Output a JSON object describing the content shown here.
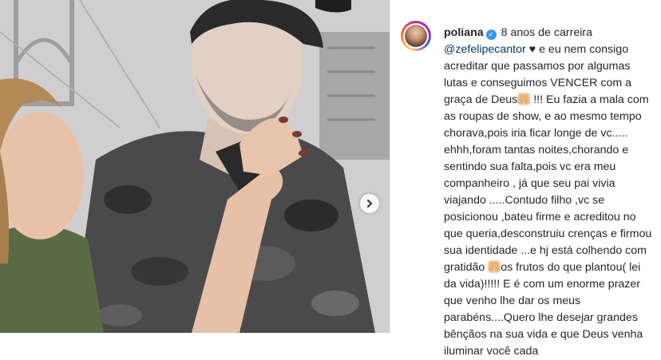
{
  "post": {
    "author": {
      "username": "poliana",
      "verified": true
    },
    "caption": {
      "line1": "8 anos de carreira",
      "mention": "@zefelipecantor",
      "heart": "♥",
      "segment1": "e eu nem consigo acreditar que passamos por algumas lutas e conseguimos VENCER com a graça de Deus",
      "segment2": "!!! Eu fazia a mala com as roupas de show, e ao mesmo tempo chorava,pois iria ficar longe de vc..... ehhh,foram tantas noites,chorando e sentindo sua falta,pois vc era meu companheiro , já que seu pai vivia viajando .....Contudo filho ,vc se posicionou ,bateu firme e acreditou no que queria,desconstruiu crenças e firmou sua identidade ...e hj está colhendo com gratidão",
      "segment3": "os frutos do que plantou( lei da vida)!!!!! E é com um enorme prazer que venho lhe dar os meus parabéns....Quero lhe desejar grandes bênçãos na sua vida e que Deus venha iluminar você cada"
    },
    "emoji_icon": "praying-hands-emoji",
    "photo_icon": "photo",
    "carousel_next_icon": "chevron-right-icon",
    "colors": {
      "verified_badge": "#3897f0",
      "mention": "#00376b",
      "text": "#262626"
    }
  }
}
